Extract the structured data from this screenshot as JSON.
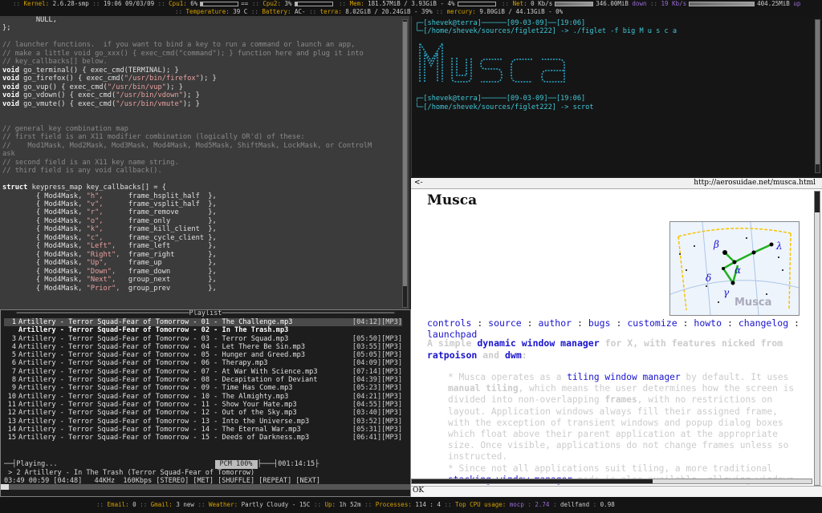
{
  "topbar": {
    "line1": [
      {
        "label": "Kernel:",
        "value": "2.6.28-smp"
      },
      {
        "label": "",
        "value": "19:06 09/03/09"
      },
      {
        "label": "Cpu1:",
        "value": "6%",
        "bar": true
      },
      {
        "label": "",
        "value": "==",
        "extra": true
      },
      {
        "label": "Cpu2:",
        "value": "3%",
        "bar": true
      },
      {
        "label": "Mem:",
        "value": "181.57MiB / 3.93GiB - 4%",
        "bar": true
      },
      {
        "label": "Net:",
        "value": "0 Kb/s"
      }
    ],
    "net_down_value": "346.00MiB",
    "net_down_label": "down",
    "net_up_rate": "19 Kb/s",
    "net_up_value": "404.25MiB",
    "net_up_label": "up",
    "line2": [
      {
        "label": "Temperature:",
        "value": "39 C"
      },
      {
        "label": "Battery:",
        "value": "AC-"
      },
      {
        "label": "terra:",
        "value": "8.02GiB / 20.24GiB - 39%"
      },
      {
        "label": "mercury:",
        "value": "9.80GiB / 44.13GiB - 0%"
      }
    ]
  },
  "editor": {
    "lines": [
      {
        "c": "norm",
        "t": "        NULL,"
      },
      {
        "c": "norm",
        "t": "};"
      },
      {
        "c": "norm",
        "t": ""
      },
      {
        "c": "comment",
        "t": "// launcher functions.  if you want to bind a key to run a command or launch an app,"
      },
      {
        "c": "comment",
        "t": "// make a little void go_xxx() { exec_cmd(\"command\"); } function here and plug it into"
      },
      {
        "c": "comment",
        "t": "// key_callbacks[] below."
      },
      {
        "c": "code",
        "kw": "void",
        "t": " go_terminal() { exec_cmd(TERMINAL); }"
      },
      {
        "c": "code",
        "kw": "void",
        "t": " go_firefox() { exec_cmd(",
        "s": "\"/usr/bin/firefox\"",
        "e": "); }"
      },
      {
        "c": "code",
        "kw": "void",
        "t": " go_vup() { exec_cmd(",
        "s": "\"/usr/bin/vup\"",
        "e": "); }"
      },
      {
        "c": "code",
        "kw": "void",
        "t": " go_vdown() { exec_cmd(",
        "s": "\"/usr/bin/vdown\"",
        "e": "); }"
      },
      {
        "c": "code",
        "kw": "void",
        "t": " go_vmute() { exec_cmd(",
        "s": "\"/usr/bin/vmute\"",
        "e": "); }"
      },
      {
        "c": "norm",
        "t": ""
      },
      {
        "c": "norm",
        "t": ""
      },
      {
        "c": "comment",
        "t": "// general key combination map"
      },
      {
        "c": "comment",
        "t": "// first field is an X11 modifier combination (logically OR'd) of these:"
      },
      {
        "c": "comment",
        "t": "//    Mod1Mask, Mod2Mask, Mod3Mask, Mod4Mask, Mod5Mask, ShiftMask, LockMask, or ControlM"
      },
      {
        "c": "comment",
        "t": "ask"
      },
      {
        "c": "comment",
        "t": "// second field is an X11 key name string."
      },
      {
        "c": "comment",
        "t": "// third field is any void callback()."
      },
      {
        "c": "norm",
        "t": ""
      },
      {
        "c": "code",
        "kw": "struct",
        "t": " keypress_map key_callbacks[] = {"
      },
      {
        "c": "map",
        "k": "\"h\",",
        "f": "frame_hsplit_half  },"
      },
      {
        "c": "map",
        "k": "\"v\",",
        "f": "frame_vsplit_half  },"
      },
      {
        "c": "map",
        "k": "\"r\",",
        "f": "frame_remove       },"
      },
      {
        "c": "map",
        "k": "\"o\",",
        "f": "frame_only         },"
      },
      {
        "c": "map",
        "k": "\"k\",",
        "f": "frame_kill_client  },"
      },
      {
        "c": "map",
        "k": "\"c\",",
        "f": "frame_cycle_client },"
      },
      {
        "c": "map",
        "k": "\"Left\",",
        "f": "frame_left         },"
      },
      {
        "c": "map",
        "k": "\"Right\",",
        "f": "frame_right        },"
      },
      {
        "c": "map",
        "k": "\"Up\",",
        "f": "frame_up           },"
      },
      {
        "c": "map",
        "k": "\"Down\",",
        "f": "frame_down         },"
      },
      {
        "c": "map",
        "k": "\"Next\",",
        "f": "group_next         },"
      },
      {
        "c": "map",
        "k": "\"Prior\",",
        "f": "group_prev         },"
      }
    ]
  },
  "terminal": {
    "prompt1_user": "[shevek@terra]",
    "prompt1_date": "[09-03-09]",
    "prompt1_time": "[19:06]",
    "prompt1_path": "[/home/shevek/sources/figlet222]",
    "prompt1_cmd": "./figlet -f big M u s c a",
    "prompt2_user": "[shevek@terra]",
    "prompt2_date": "[09-03-09]",
    "prompt2_time": "[19:06]",
    "prompt2_path": "[/home/shevek/sources/figlet222]",
    "prompt2_cmd": "scrot"
  },
  "player": {
    "title": "Playlist",
    "tracks": [
      {
        "n": "1",
        "t": "Artillery - Terror Squad-Fear of Tomorrow - 01 - The Challenge.mp3",
        "d": "[04:12][MP3]"
      },
      {
        "n": "",
        "t": "Artillery - Terror Squad-Fear of Tomorrow - 02 - In The Trash.mp3",
        "d": ""
      },
      {
        "n": "3",
        "t": "Artillery - Terror Squad-Fear of Tomorrow - 03 - Terror Squad.mp3",
        "d": "[05:50][MP3]"
      },
      {
        "n": "4",
        "t": "Artillery - Terror Squad-Fear of Tomorrow - 04 - Let There Be Sin.mp3",
        "d": "[03:55][MP3]"
      },
      {
        "n": "5",
        "t": "Artillery - Terror Squad-Fear of Tomorrow - 05 - Hunger and Greed.mp3",
        "d": "[05:05][MP3]"
      },
      {
        "n": "6",
        "t": "Artillery - Terror Squad-Fear of Tomorrow - 06 - Therapy.mp3",
        "d": "[04:09][MP3]"
      },
      {
        "n": "7",
        "t": "Artillery - Terror Squad-Fear of Tomorrow - 07 - At War With Science.mp3",
        "d": "[07:14][MP3]"
      },
      {
        "n": "8",
        "t": "Artillery - Terror Squad-Fear of Tomorrow - 08 - Decapitation of Deviant",
        "d": "[04:39][MP3]"
      },
      {
        "n": "9",
        "t": "Artillery - Terror Squad-Fear of Tomorrow - 09 - Time Has Come.mp3",
        "d": "[05:23][MP3]"
      },
      {
        "n": "10",
        "t": "Artillery - Terror Squad-Fear of Tomorrow - 10 - The Almighty.mp3",
        "d": "[04:21][MP3]"
      },
      {
        "n": "11",
        "t": "Artillery - Terror Squad-Fear of Tomorrow - 11 - Show Your Hate.mp3",
        "d": "[04:55][MP3]"
      },
      {
        "n": "12",
        "t": "Artillery - Terror Squad-Fear of Tomorrow - 12 - Out of the Sky.mp3",
        "d": "[03:40][MP3]"
      },
      {
        "n": "13",
        "t": "Artillery - Terror Squad-Fear of Tomorrow - 13 - Into the Universe.mp3",
        "d": "[03:52][MP3]"
      },
      {
        "n": "14",
        "t": "Artillery - Terror Squad-Fear of Tomorrow - 14 - The Eternal War.mp3",
        "d": "[05:31][MP3]"
      },
      {
        "n": "15",
        "t": "Artillery - Terror Squad-Fear of Tomorrow - 15 - Deeds of Darkness.mp3",
        "d": "[06:41][MP3]"
      }
    ],
    "status_label": "Playing...",
    "pcm": "PCM 100%",
    "total_time": "001:14:15",
    "now_playing": "> 2 Artillery - In The Trash (Terror Squad-Fear of Tomorrow)",
    "tech_line": "03:49 00:59 [04:48]   44KHz  160Kbps [STEREO] [MET] [SHUFFLE] [REPEAT] [NEXT]",
    "progress": 0.02
  },
  "browser": {
    "back": "<-",
    "url": "http://aerosuidae.net/musca.html",
    "heading": "Musca",
    "constellation_label": "Musca",
    "links": [
      "controls",
      "source",
      "author",
      "bugs",
      "customize",
      "howto",
      "changelog",
      "launchpad"
    ],
    "lead_a": "A simple",
    "lead_link1": "dynamic window manager",
    "lead_b": "for X, with features nicked from",
    "lead_link2": "ratpoison",
    "lead_c": "and",
    "lead_link3": "dwm",
    "lead_d": ":",
    "para1_a": "* Musca operates as a",
    "para1_link": "tiling window manager",
    "para1_b": "by default. It uses",
    "para1_bold": "manual tiling",
    "para1_c": ", which means the user determines how the screen is divided into non-overlapping",
    "para1_bold2": "frames",
    "para1_d": ", with no restrictions on layout. Application windows always fill their assigned frame, with the exception of transient windows and popup dialog boxes which float above their parent application at the appropriate size. Once visible, applications do not change frames unless so instructed.",
    "para2_a": "* Since not all applications suit tiling, a more traditional",
    "para2_link": "stacking window manager",
    "para2_b": "mode is also available, allowing windows to float at any screen",
    "footer": "OK"
  },
  "bottombar": {
    "items": [
      {
        "label": "Email:",
        "value": "0"
      },
      {
        "label": "Gmail:",
        "value": "3 new"
      },
      {
        "label": "Weather:",
        "value": "Partly Cloudy - 15C"
      },
      {
        "label": "Up:",
        "value": "1h 52m"
      },
      {
        "label": "Processes:",
        "value": "114 : 4"
      },
      {
        "label": "Top CPU usage:",
        "value": "mocp"
      }
    ],
    "cpu_top": "2.74",
    "proc2": "dellfand",
    "proc2_val": "0.98"
  }
}
